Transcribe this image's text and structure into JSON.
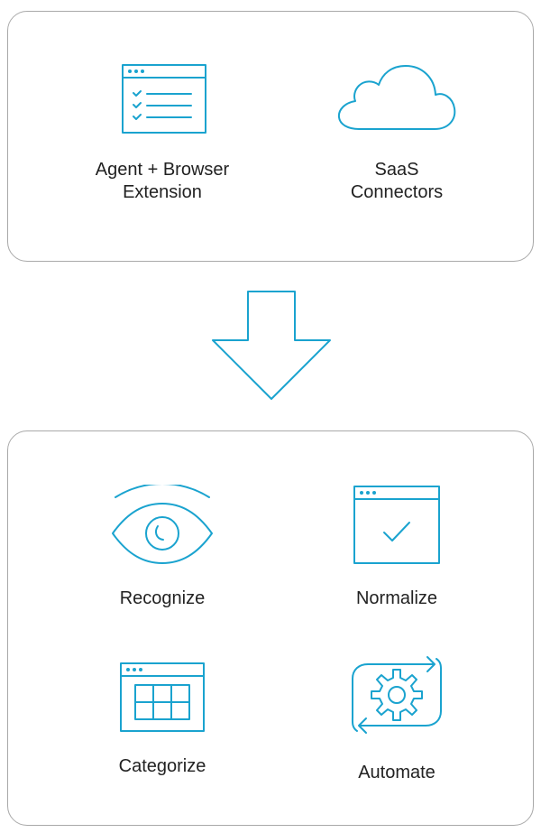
{
  "top_panel": {
    "items": [
      {
        "label_line1": "Agent + Browser",
        "label_line2": "Extension",
        "icon": "browser-checklist-icon"
      },
      {
        "label_line1": "SaaS",
        "label_line2": "Connectors",
        "icon": "cloud-icon"
      }
    ]
  },
  "arrow": {
    "icon": "down-arrow-icon"
  },
  "bottom_panel": {
    "items": [
      {
        "label": "Recognize",
        "icon": "eye-icon"
      },
      {
        "label": "Normalize",
        "icon": "browser-check-icon"
      },
      {
        "label": "Categorize",
        "icon": "browser-grid-icon"
      },
      {
        "label": "Automate",
        "icon": "gear-cycle-icon"
      }
    ]
  },
  "colors": {
    "accent": "#1aa3cf",
    "border": "#a9a9a9",
    "text": "#222222"
  }
}
